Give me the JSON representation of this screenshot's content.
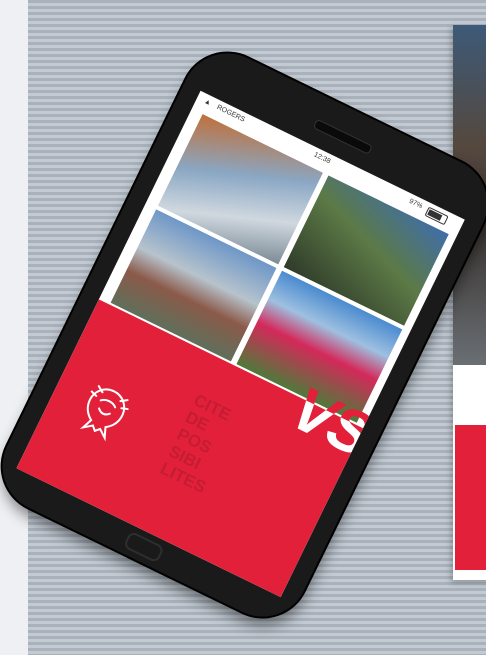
{
  "status_bar": {
    "carrier": "ROGERS",
    "time": "12:38",
    "battery": "97%"
  },
  "poster": {
    "accent": "#e3203a"
  },
  "screen": {
    "headline": "VS",
    "slogan_lines": [
      "CITE",
      "DE",
      "POS",
      "SIBI",
      "LITES"
    ],
    "logo_icon": "lion-icon",
    "brand_red": "#e3203a"
  }
}
